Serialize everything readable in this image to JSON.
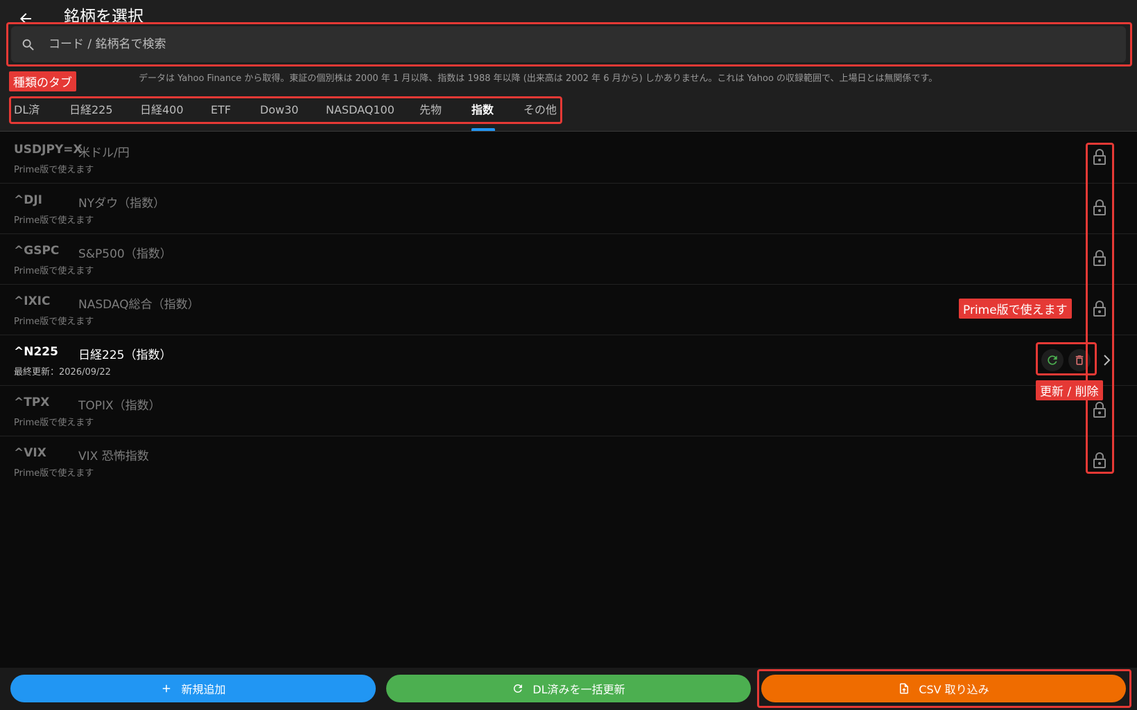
{
  "header": {
    "title": "銘柄を選択",
    "search_placeholder": "コード / 銘柄名で検索",
    "info": "データは Yahoo Finance から取得。東証の個別株は 2000 年 1 月以降、指数は 1988 年以降 (出来高は 2002 年 6 月から) しかありません。これは Yahoo の収録範囲で、上場日とは無関係です。"
  },
  "tabs": [
    {
      "label": "DL済"
    },
    {
      "label": "日経225"
    },
    {
      "label": "日経400"
    },
    {
      "label": "ETF"
    },
    {
      "label": "Dow30"
    },
    {
      "label": "NASDAQ100"
    },
    {
      "label": "先物"
    },
    {
      "label": "指数",
      "active": true
    },
    {
      "label": "その他"
    }
  ],
  "rows": [
    {
      "code": "USDJPY=X",
      "name": "米ドル/円",
      "sub": "Prime版で使えます",
      "locked": true
    },
    {
      "code": "^DJI",
      "name": "NYダウ（指数）",
      "sub": "Prime版で使えます",
      "locked": true
    },
    {
      "code": "^GSPC",
      "name": "S&P500（指数）",
      "sub": "Prime版で使えます",
      "locked": true
    },
    {
      "code": "^IXIC",
      "name": "NASDAQ総合（指数）",
      "sub": "Prime版で使えます",
      "locked": true
    },
    {
      "code": "^N225",
      "name": "日経225（指数）",
      "sub": "最終更新：2026/09/22",
      "locked": false
    },
    {
      "code": "^TPX",
      "name": "TOPIX（指数）",
      "sub": "Prime版で使えます",
      "locked": true
    },
    {
      "code": "^VIX",
      "name": "VIX 恐怖指数",
      "sub": "Prime版で使えます",
      "locked": true
    }
  ],
  "annotations": {
    "tabs_label": "種類のタブ",
    "prime_label": "Prime版で使えます",
    "actions_label": "更新 / 削除"
  },
  "footer": {
    "add_label": "新規追加",
    "refresh_label": "DL済みを一括更新",
    "csv_label": "CSV 取り込み"
  },
  "colors": {
    "accent_blue": "#2196f3",
    "accent_green": "#4caf50",
    "accent_orange": "#ef6c00",
    "annotation_red": "#e53935"
  },
  "icons": [
    "back-arrow-icon",
    "search-icon",
    "lock-icon",
    "refresh-icon",
    "trash-icon",
    "chevron-right-icon",
    "plus-icon",
    "file-upload-icon"
  ]
}
